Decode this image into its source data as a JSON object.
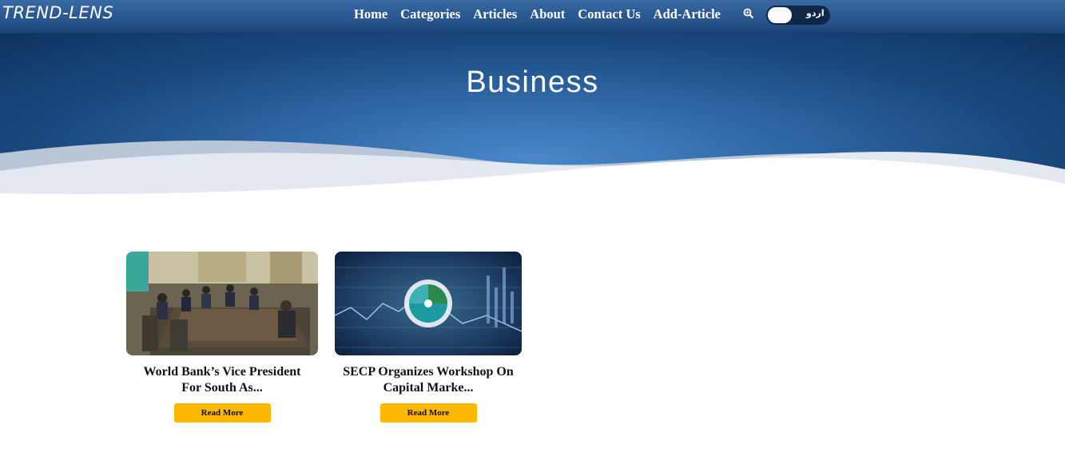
{
  "navbar": {
    "logo": "TREND-LENS",
    "links": [
      "Home",
      "Categories",
      "Articles",
      "About",
      "Contact Us",
      "Add-Article"
    ],
    "search_icon": "search-icon",
    "language_toggle": {
      "label": "اردو"
    }
  },
  "hero": {
    "title": "Business"
  },
  "articles": [
    {
      "title_line1": "World Bank’s Vice President",
      "title_line2": "For South As...",
      "button": "Read More"
    },
    {
      "title_line1": "SECP Organizes Workshop On",
      "title_line2": "Capital Marke...",
      "button": "Read More"
    }
  ],
  "colors": {
    "accent": "#ffb800",
    "nav": "#2b5a93",
    "hero": "#2f67a5"
  }
}
